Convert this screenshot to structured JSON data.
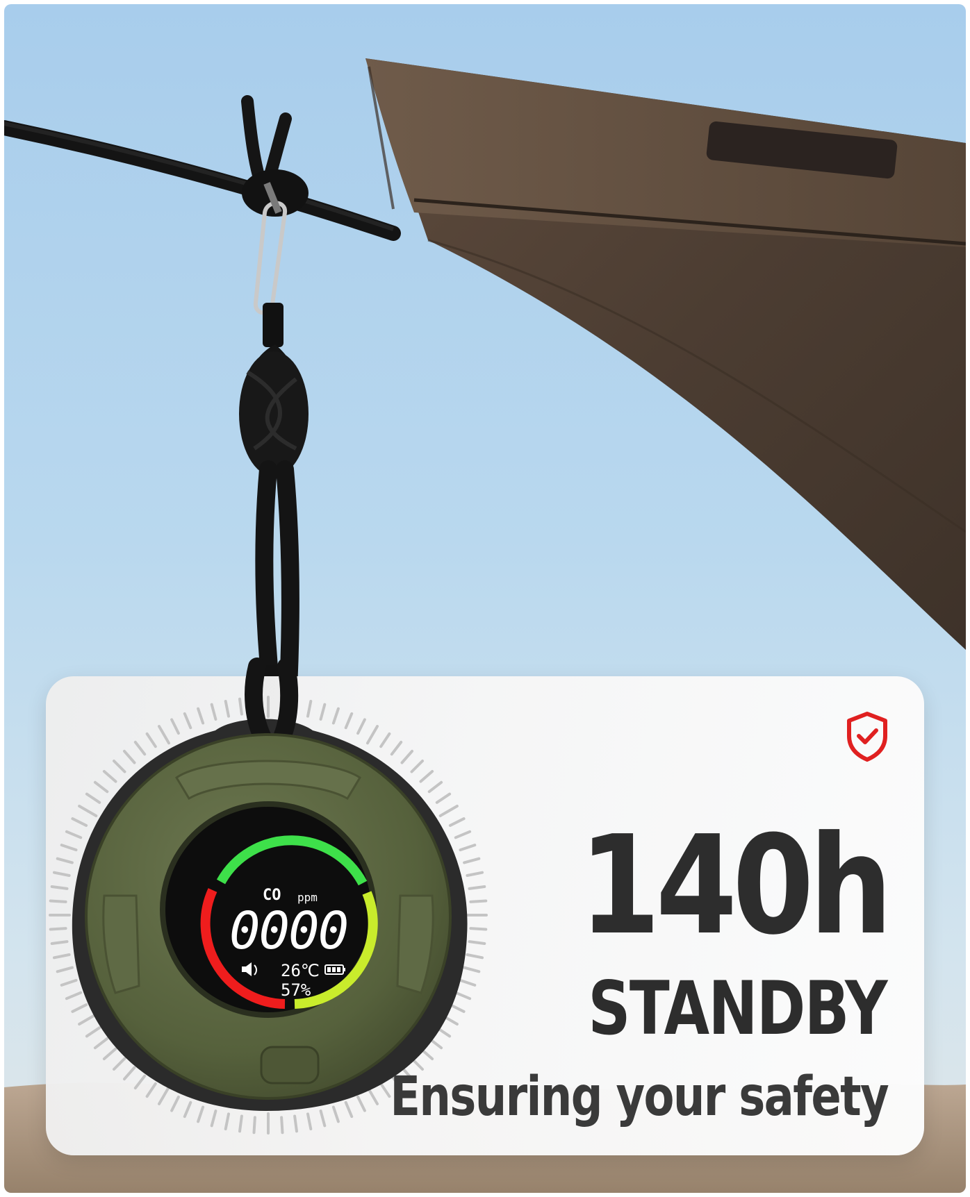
{
  "feature": {
    "headline": "140h",
    "subhead": "STANDBY",
    "tagline": "Ensuring your safety",
    "badge_icon": "shield-check-icon",
    "badge_color": "#e02020"
  },
  "device": {
    "gas_label": "CO",
    "unit_label": "ppm",
    "reading": "0000",
    "temperature": "26℃",
    "humidity": "57%",
    "sound_icon": "speaker-icon",
    "battery_icon": "battery-icon",
    "gauge_colors": {
      "safe": "#3ee04a",
      "warning": "#c9ec2c",
      "danger": "#ef1d1d"
    },
    "body_color": "#56613c"
  }
}
